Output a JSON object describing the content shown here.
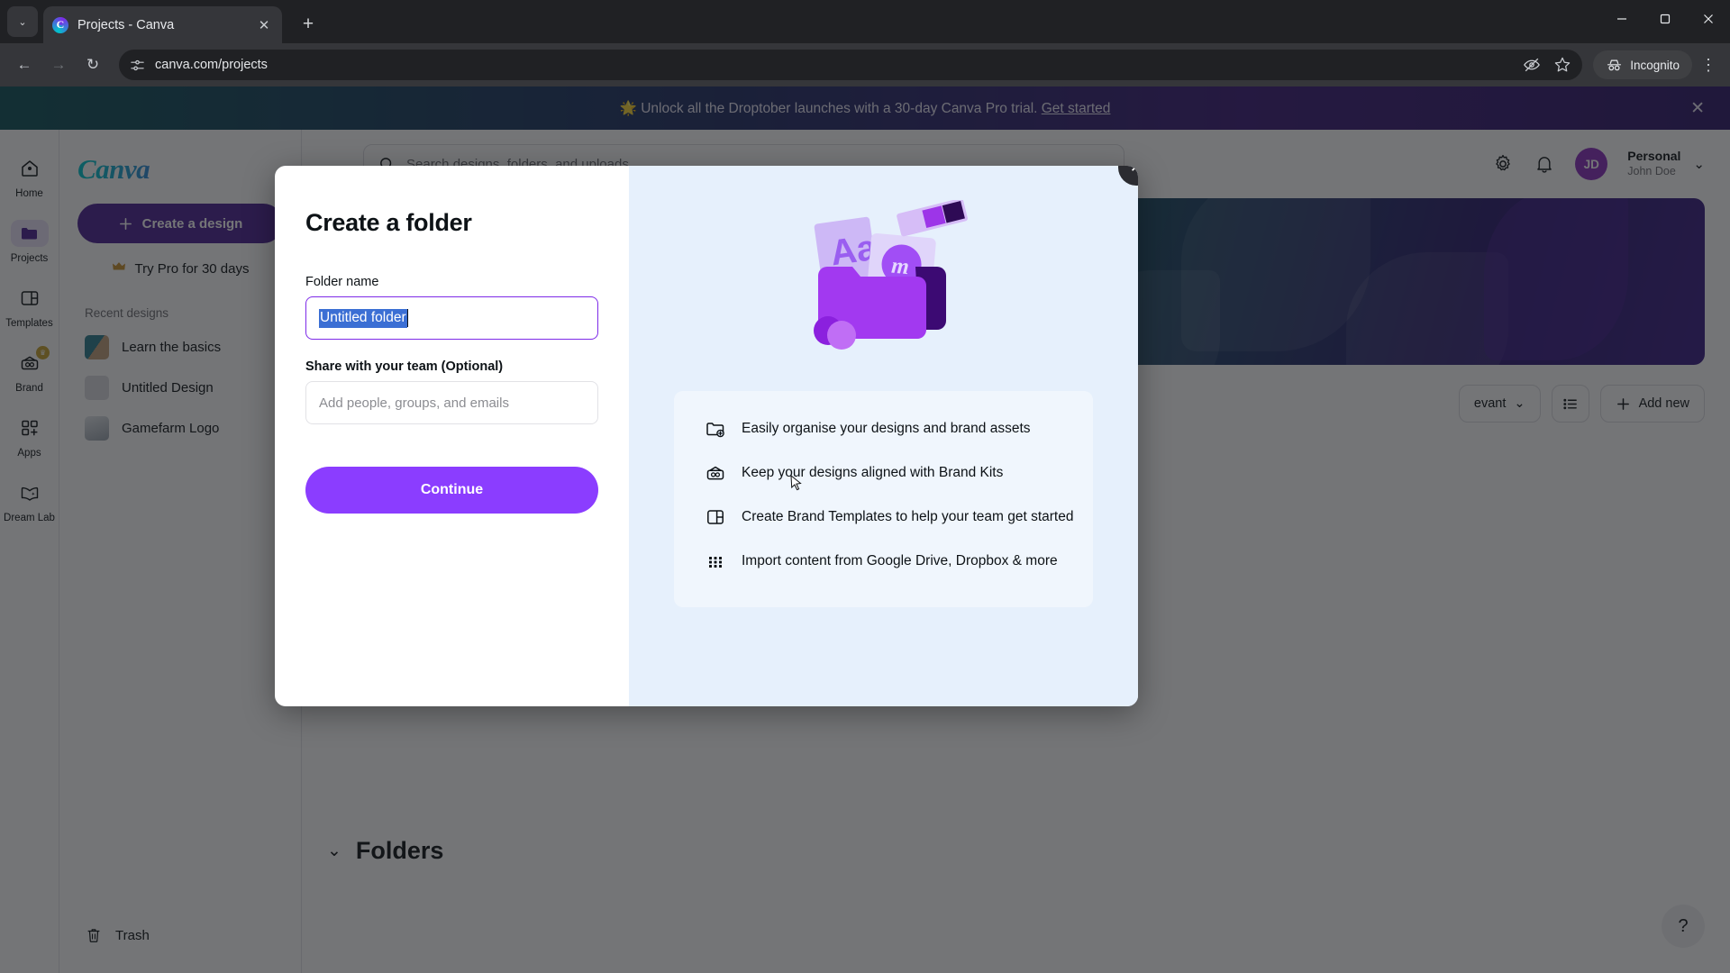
{
  "browser": {
    "tab": {
      "title": "Projects - Canva",
      "favicon": "canva-favicon",
      "close_label": "✕"
    },
    "tab_list_label": "⌄",
    "new_tab_label": "+",
    "window": {
      "minimize": "–",
      "maximize": "❐",
      "close": "✕"
    },
    "nav": {
      "back": "←",
      "forward": "→",
      "reload": "↻"
    },
    "omnibox": {
      "url": "canva.com/projects",
      "site_info_icon": "tune-icon"
    },
    "incognito_label": "Incognito",
    "menu_label": "⋮"
  },
  "promo": {
    "icon": "🌟",
    "text": "Unlock all the Droptober launches with a 30-day Canva Pro trial. ",
    "link": "Get started",
    "close": "✕"
  },
  "rail": {
    "items": [
      {
        "label": "Home",
        "icon": "home-icon",
        "active": false,
        "badge": ""
      },
      {
        "label": "Projects",
        "icon": "folder-icon",
        "active": true,
        "badge": ""
      },
      {
        "label": "Templates",
        "icon": "templates-icon",
        "active": false,
        "badge": ""
      },
      {
        "label": "Brand",
        "icon": "brand-icon",
        "active": false,
        "badge": "♛"
      },
      {
        "label": "Apps",
        "icon": "apps-icon",
        "active": false,
        "badge": ""
      },
      {
        "label": "Dream Lab",
        "icon": "dream-lab-icon",
        "active": false,
        "badge": ""
      }
    ]
  },
  "sidebar": {
    "logo": "Canva",
    "create_button": "Create a design",
    "try_pro": "Try Pro for 30 days",
    "recent_heading": "Recent designs",
    "recent": [
      {
        "name": "Learn the basics",
        "color1": "#2b7d8f",
        "color2": "#c2a07a"
      },
      {
        "name": "Untitled Design",
        "color1": "#dcdce0",
        "color2": "#e6e6ea"
      },
      {
        "name": "Gamefarm Logo",
        "color1": "#d8dde3",
        "color2": "#9aa3ad"
      }
    ],
    "trash": "Trash"
  },
  "header": {
    "search_placeholder": "Search designs, folders, and uploads",
    "settings_icon": "gear-icon",
    "notifications_icon": "bell-icon",
    "avatar_initials": "JD",
    "account_name": "Personal",
    "account_user": "John Doe",
    "account_chevron": "⌄"
  },
  "toolbar": {
    "sort_label": "evant",
    "sort_chevron": "⌄",
    "view_icon": "list-view-icon",
    "add_new": "Add new",
    "add_icon": "plus-icon"
  },
  "sections": {
    "folders_title": "Folders",
    "folders_chevron": "⌄"
  },
  "help_button": "?",
  "modal": {
    "title": "Create a folder",
    "folder_name_label": "Folder name",
    "folder_name_value": "Untitled folder",
    "share_label": "Share with your team (Optional)",
    "share_placeholder": "Add people, groups, and emails",
    "continue_label": "Continue",
    "close_label": "✕",
    "features": [
      {
        "icon": "folder-plus-icon",
        "text": "Easily organise your designs and brand assets"
      },
      {
        "icon": "brand-kit-icon",
        "text": "Keep your designs aligned with Brand Kits"
      },
      {
        "icon": "brand-template-icon",
        "text": "Create Brand Templates to help your team get started"
      },
      {
        "icon": "grid-apps-icon",
        "text": "Import content from Google Drive, Dropbox & more"
      }
    ]
  },
  "colors": {
    "canva_purple": "#8B3DFF",
    "deep_purple": "#4D2294",
    "selection_blue": "#3B6FD4",
    "panel_blue": "#E6F0FC"
  }
}
